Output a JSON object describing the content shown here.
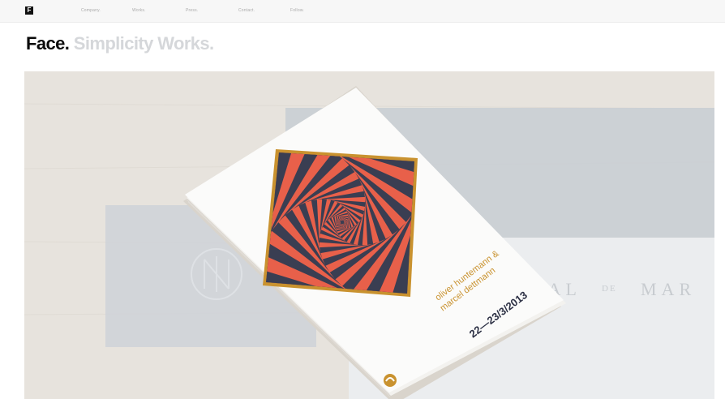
{
  "header": {
    "logo_letter": "F",
    "nav_items": [
      "Company.",
      "Works.",
      "Press.",
      "Contact.",
      "Follow."
    ]
  },
  "headline": {
    "brand": "Face.",
    "tagline": "Simplicity Works."
  },
  "hero": {
    "card_names": [
      "oliver huntemann &",
      "marcel dettmann"
    ],
    "card_date": "22—23/3/2013",
    "card2_text": [
      "MAL",
      "DE",
      "MAR"
    ],
    "colors": {
      "stripe_red": "#e8604a",
      "stripe_navy": "#3a3e52",
      "gold": "#c9922f"
    }
  }
}
